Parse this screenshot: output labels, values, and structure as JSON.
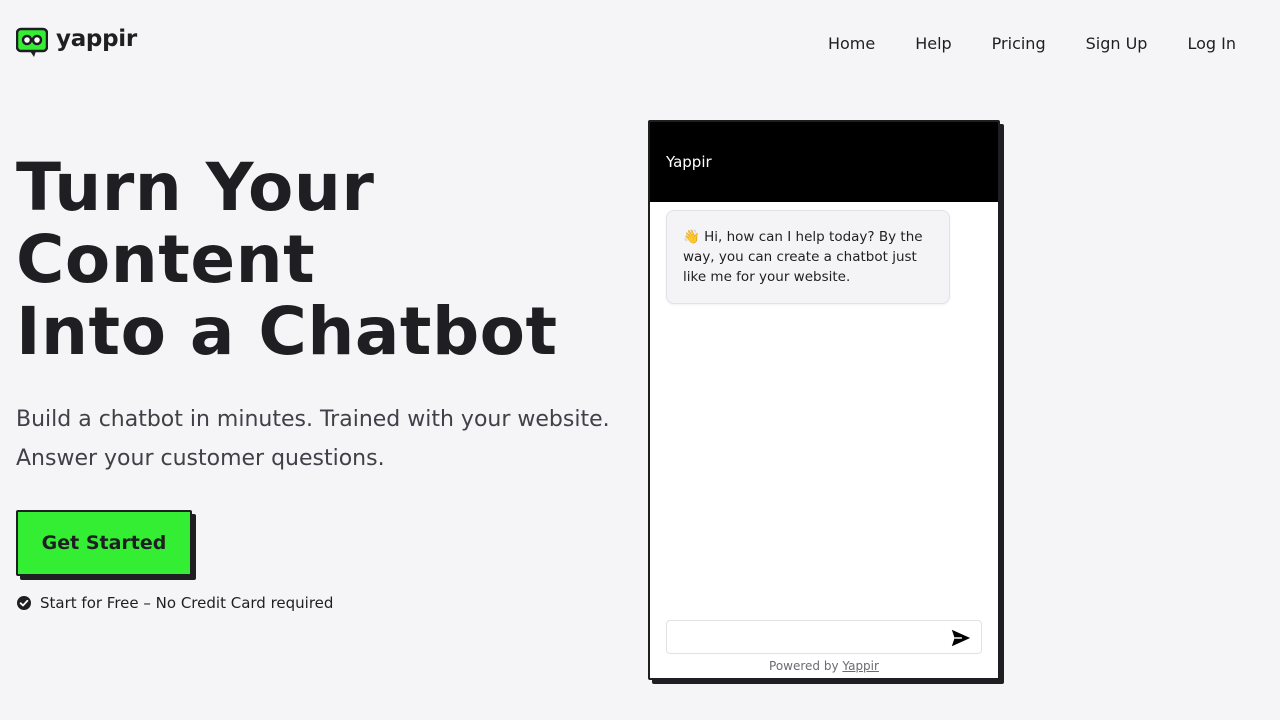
{
  "header": {
    "logo_text": "yappir",
    "nav": [
      "Home",
      "Help",
      "Pricing",
      "Sign Up",
      "Log In"
    ]
  },
  "hero": {
    "title_lines": [
      "Turn Your",
      "Content",
      "Into a Chatbot"
    ],
    "subtitle_lines": [
      "Build a chatbot in minutes. Trained with your website.",
      "Answer your customer questions."
    ],
    "cta_label": "Get Started",
    "note": "Start for Free – No Credit Card required"
  },
  "chat": {
    "title": "Yappir",
    "greeting_emoji": "👋",
    "greeting": " Hi, how can I help today? By the way, you can create a chatbot just like me for your website.",
    "input_value": "",
    "input_placeholder": "",
    "powered_prefix": "Powered by ",
    "powered_link": "Yappir"
  },
  "icons": {
    "logo": "speech-bubble-robot-icon",
    "check": "check-circle-icon",
    "send": "paper-plane-send-icon"
  },
  "colors": {
    "background": "#f5f5f7",
    "accent": "#33ee33",
    "text": "#1f1f23",
    "chat_header": "#000000"
  }
}
